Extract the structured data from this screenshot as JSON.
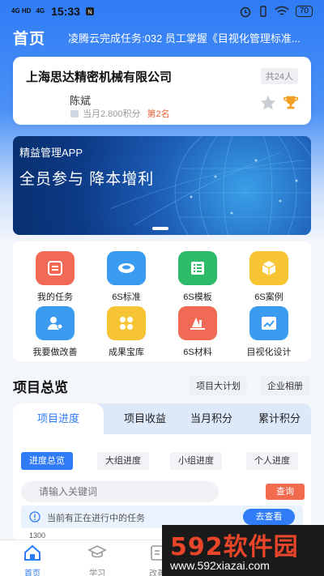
{
  "status_bar": {
    "signal1": "4G HD",
    "signal2": "4G",
    "time": "15:33",
    "battery": "70"
  },
  "header": {
    "title": "首页",
    "marquee": "凌腾云完成任务:032 员工掌握《目视化管理标准..."
  },
  "company_card": {
    "company": "上海思达精密机械有限公司",
    "total_badge": "共24人",
    "user_name": "陈斌",
    "points": "当月2.800积分",
    "rank": "第2名"
  },
  "banner": {
    "app_name": "精益管理APP",
    "slogan": "全员参与  降本增利"
  },
  "features": [
    {
      "label": "我的任务",
      "icon": "task-list-icon",
      "color": "#f06a55"
    },
    {
      "label": "6S标准",
      "icon": "tape-measure-icon",
      "color": "#3a9bf0"
    },
    {
      "label": "6S模板",
      "icon": "template-grid-icon",
      "color": "#2dbb6a"
    },
    {
      "label": "6S案例",
      "icon": "cube-icon",
      "color": "#f7c534"
    },
    {
      "label": "我要做改善",
      "icon": "user-edit-icon",
      "color": "#3a9bf0"
    },
    {
      "label": "成果宝库",
      "icon": "four-dots-icon",
      "color": "#f7c534"
    },
    {
      "label": "6S材料",
      "icon": "book-stack-icon",
      "color": "#f06a55"
    },
    {
      "label": "目视化设计",
      "icon": "trend-chart-icon",
      "color": "#3a9bf0"
    }
  ],
  "overview": {
    "title": "项目总览",
    "plan_link": "项目大计划",
    "album_link": "企业相册",
    "tabs": [
      "项目进度",
      "项目收益",
      "当月积分",
      "累计积分"
    ],
    "pills": [
      "进度总览",
      "大组进度",
      "小组进度",
      "个人进度"
    ],
    "search_placeholder": "请输入关键词",
    "query_button": "查询",
    "notice_text": "当前有正在进行中的任务",
    "notice_button": "去查看",
    "y_tick": "1300"
  },
  "tabbar": {
    "items": [
      {
        "label": "首页"
      },
      {
        "label": "学习"
      },
      {
        "label": "改善"
      }
    ]
  },
  "watermark": {
    "brand": "592软件园",
    "url": "www.592xiazai.com"
  },
  "colors": {
    "primary": "#2f7cf6",
    "accent_orange": "#f26b4f",
    "rank_orange": "#e8653b"
  }
}
